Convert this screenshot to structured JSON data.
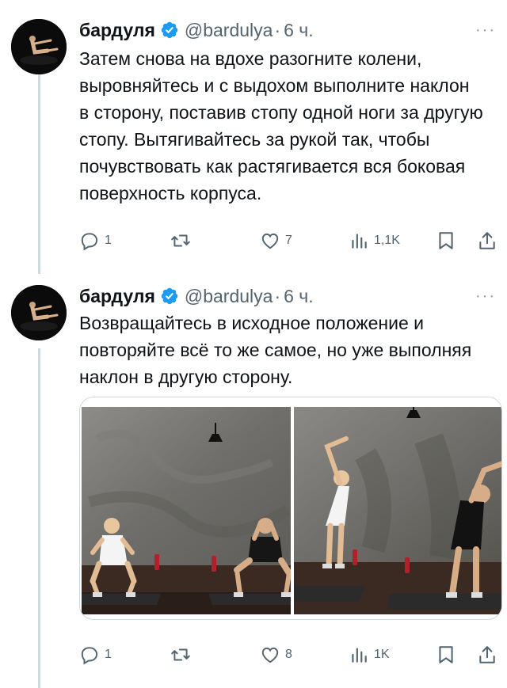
{
  "tweets": [
    {
      "author_name": "бардуля",
      "handle": "@bardulya",
      "separator": "·",
      "time": "6 ч.",
      "text": "Затем снова на вдохе разогните колени, выровняйтесь и с выдохом выполните наклон в сторону, поставив стопу одной ноги за другую стопу. Вытягивайтесь за рукой так, чтобы почувствовать как растягивается вся боковая поверхность корпуса.",
      "replies": "1",
      "reposts": "",
      "likes": "7",
      "views": "1,1K"
    },
    {
      "author_name": "бардуля",
      "handle": "@bardulya",
      "separator": "·",
      "time": "6 ч.",
      "text": "Возвращайтесь в исходное положение и повторяйте всё то же самое, но уже выполняя наклон в другую сторону.",
      "replies": "1",
      "reposts": "",
      "likes": "8",
      "views": "1K"
    }
  ],
  "icons": {
    "verified": "verified-badge-icon",
    "more": "more-dots-icon",
    "reply": "reply-bubble-icon",
    "repost": "repost-arrows-icon",
    "like": "heart-icon",
    "views": "views-bars-icon",
    "bookmark": "bookmark-icon",
    "share": "share-upload-icon"
  },
  "colors": {
    "text": "#0f1419",
    "secondary": "#536471",
    "verified": "#1d9bf0",
    "divider": "#cfd9de"
  }
}
